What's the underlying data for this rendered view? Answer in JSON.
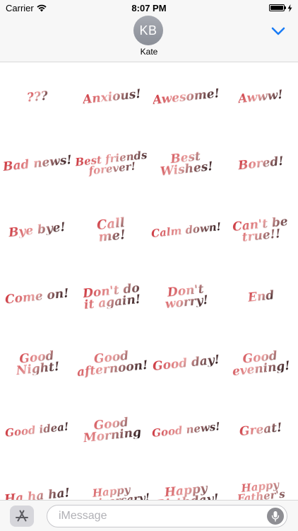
{
  "status_bar": {
    "carrier": "Carrier",
    "time": "8:07 PM",
    "battery_level": 1.0
  },
  "header": {
    "avatar_initials": "KB",
    "contact_name": "Kate",
    "collapse_icon": "chevron-down-icon",
    "accent_color": "#1a7cf5"
  },
  "stickers": [
    {
      "text": "???"
    },
    {
      "text": "Anxious!"
    },
    {
      "text": "Awesome!"
    },
    {
      "text": "Awww!"
    },
    {
      "text": "Bad news!"
    },
    {
      "text": "Best friends\nforever!"
    },
    {
      "text": "Best\nWishes!"
    },
    {
      "text": "Bored!"
    },
    {
      "text": "Bye bye!"
    },
    {
      "text": "Call\nme!"
    },
    {
      "text": "Calm down!"
    },
    {
      "text": "Can't be\ntrue!!"
    },
    {
      "text": "Come on!"
    },
    {
      "text": "Don't do\nit again!"
    },
    {
      "text": "Don't\nworry!"
    },
    {
      "text": "End"
    },
    {
      "text": "Good\nNight!"
    },
    {
      "text": "Good\nafternoon!"
    },
    {
      "text": "Good day!"
    },
    {
      "text": "Good\nevening!"
    },
    {
      "text": "Good idea!"
    },
    {
      "text": "Good\nMorning"
    },
    {
      "text": "Good news!"
    },
    {
      "text": "Great!"
    },
    {
      "text": "Ha ha ha!"
    },
    {
      "text": "Happy\nAnniversary!"
    },
    {
      "text": "Happy\nBirthday!"
    },
    {
      "text": "Happy\nFather's Day!"
    }
  ],
  "bottom_bar": {
    "appstore_icon": "appstore-icon",
    "message_placeholder": "iMessage",
    "mic_icon": "microphone-icon"
  }
}
